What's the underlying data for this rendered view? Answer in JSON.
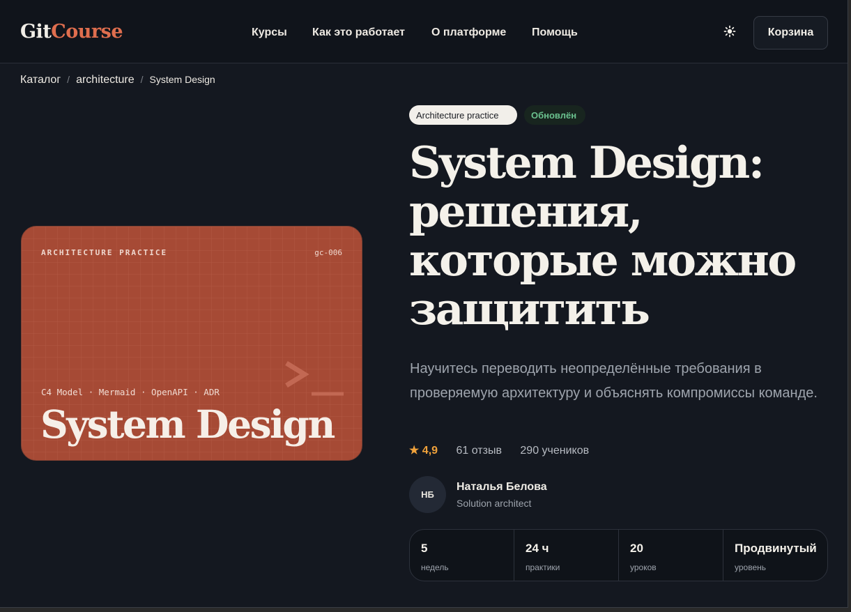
{
  "header": {
    "logo_part1": "Git",
    "logo_part2": "Course",
    "nav": [
      "Курсы",
      "Как это работает",
      "О платформе",
      "Помощь"
    ],
    "theme_icon": "sun-icon",
    "cart_label": "Корзина"
  },
  "breadcrumb": [
    "Каталог",
    "architecture",
    "System Design"
  ],
  "cover": {
    "kicker": "ARCHITECTURE PRACTICE",
    "code": "gc-006",
    "stack": "C4 Model · Mermaid · OpenAPI · ADR",
    "title": "System Design",
    "color": "#a64a35"
  },
  "course": {
    "tag": "Architecture practice",
    "badge": "Обновлён",
    "title": "System Design: решения, которые можно защитить",
    "lead": "Научитесь переводить неопределённые требования в проверяемую архитектуру и объяснять компромиссы команде.",
    "rating": "4,9",
    "reviews": "61 отзыв",
    "students": "290 учеников"
  },
  "author": {
    "initials": "НБ",
    "name": "Наталья Белова",
    "role": "Solution architect"
  },
  "stats": [
    {
      "value": "5",
      "label": "недель"
    },
    {
      "value": "24 ч",
      "label": "практики"
    },
    {
      "value": "20",
      "label": "уроков"
    },
    {
      "value": "Продвинутый",
      "label": "уровень"
    }
  ],
  "colors": {
    "accent": "#df6e4e",
    "background": "#141820",
    "rating_star": "#f0a23b",
    "updated_badge": "#6bc28f"
  }
}
